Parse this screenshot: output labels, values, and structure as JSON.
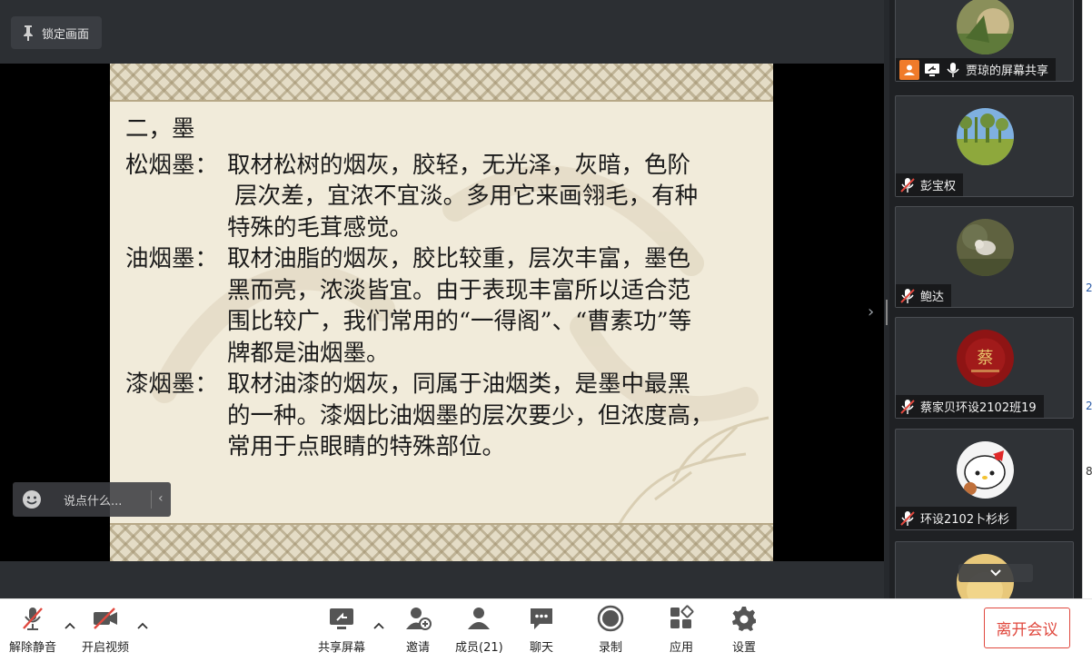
{
  "topbar": {
    "lock_label": "锁定画面"
  },
  "slide": {
    "heading": "二，墨",
    "paragraphs": [
      {
        "term": "松烟墨：",
        "lines": [
          "取材松树的烟灰，胶轻，无光泽，灰暗，色阶",
          " 层次差，宜浓不宜淡。多用它来画翎毛，有种",
          "特殊的毛茸感觉。"
        ]
      },
      {
        "term": "油烟墨：",
        "lines": [
          "取材油脂的烟灰，胶比较重，层次丰富，墨色",
          "黑而亮，浓淡皆宜。由于表现丰富所以适合范",
          "围比较广，我们常用的“一得阁”、“曹素功”等",
          "牌都是油烟墨。"
        ]
      },
      {
        "term": "漆烟墨：",
        "lines": [
          "取材油漆的烟灰，同属于油烟类，是墨中最黑",
          "的一种。漆烟比油烟墨的层次要少，但浓度高，",
          "常用于点眼睛的特殊部位。"
        ]
      }
    ]
  },
  "chat": {
    "placeholder": "说点什么..."
  },
  "participants": [
    {
      "name": "贾琼的屏幕共享",
      "avatar": "photo-plant"
    },
    {
      "name": "彭宝权",
      "avatar": "photo-forest"
    },
    {
      "name": "鲍达",
      "avatar": "photo-cat"
    },
    {
      "name": "蔡家贝环设2102班19",
      "avatar": "red-seal"
    },
    {
      "name": "环设2102卜杉杉",
      "avatar": "hello-kitty"
    },
    {
      "name": "",
      "avatar": "yellow-partial"
    }
  ],
  "edge_glyphs": [
    "2",
    "2",
    "8"
  ],
  "toolbar": {
    "unmute": "解除静音",
    "start_video": "开启视频",
    "share_screen": "共享屏幕",
    "invite": "邀请",
    "members": "成员(21)",
    "chat": "聊天",
    "record": "录制",
    "apps": "应用",
    "settings": "设置",
    "leave": "离开会议"
  },
  "colors": {
    "accent_red": "#e0483e",
    "share_orange": "#f07b2a",
    "dark_bg": "#26292d"
  }
}
